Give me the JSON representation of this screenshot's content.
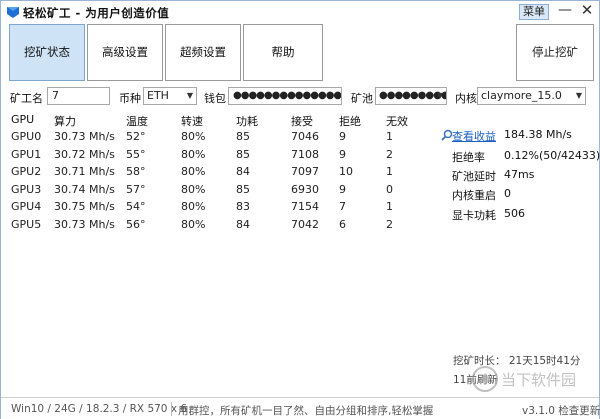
{
  "window": {
    "title": "轻松矿工 - 为用户创造价值",
    "menu_label": "菜单",
    "minimize_label": "—",
    "close_label": "✕"
  },
  "tabs": [
    {
      "label": "挖矿状态",
      "active": true
    },
    {
      "label": "高级设置",
      "active": false
    },
    {
      "label": "超频设置",
      "active": false
    },
    {
      "label": "帮助",
      "active": false
    }
  ],
  "stop_label": "停止挖矿",
  "config": {
    "worker_label": "矿工名",
    "worker_value": "7",
    "coin_label": "币种",
    "coin_value": "ETH",
    "wallet_label": "钱包",
    "wallet_value": "●●●●●●●●●●●●●●●●●●●●●●●●●●●",
    "pool_label": "矿池",
    "pool_value": "●●●●●●●●●●●●●",
    "kernel_label": "内核",
    "kernel_value": "claymore_15.0"
  },
  "table": {
    "headers": [
      "GPU",
      "算力",
      "温度",
      "转速",
      "功耗",
      "接受",
      "拒绝",
      "无效"
    ],
    "rows": [
      [
        "GPU0",
        "30.73 Mh/s",
        "52°",
        "80%",
        "85",
        "7046",
        "9",
        "1"
      ],
      [
        "GPU1",
        "30.72 Mh/s",
        "55°",
        "80%",
        "85",
        "7108",
        "9",
        "2"
      ],
      [
        "GPU2",
        "30.71 Mh/s",
        "58°",
        "80%",
        "84",
        "7097",
        "10",
        "1"
      ],
      [
        "GPU3",
        "30.74 Mh/s",
        "57°",
        "80%",
        "85",
        "6930",
        "9",
        "0"
      ],
      [
        "GPU4",
        "30.75 Mh/s",
        "54°",
        "80%",
        "83",
        "7154",
        "7",
        "1"
      ],
      [
        "GPU5",
        "30.73 Mh/s",
        "56°",
        "80%",
        "84",
        "7042",
        "6",
        "2"
      ]
    ]
  },
  "stats": {
    "view_earnings": "查看收益",
    "hashrate": "184.38 Mh/s",
    "reject_rate_label": "拒绝率",
    "reject_rate": "0.12%(50/42433)",
    "pool_latency_label": "矿池延时",
    "pool_latency": "47ms",
    "kernel_restart_label": "内核重启",
    "kernel_restart": "0",
    "gpu_power_label": "显卡功耗",
    "gpu_power": "506"
  },
  "runtime": "挖矿时长： 21天15时41分",
  "last_update": "11前刷新",
  "status": {
    "system": "Win10  / 24G / 18.2.3 / RX 570 x 6",
    "message": "用群控，所有矿机一目了然、自由分组和排序,轻松掌握",
    "version": "v3.1.0 检查更新"
  },
  "watermark_text": "当下软件园",
  "colors": {
    "active_tab": "#cfe3f7",
    "link": "#1c5fc2",
    "border": "#9a9a9a"
  }
}
